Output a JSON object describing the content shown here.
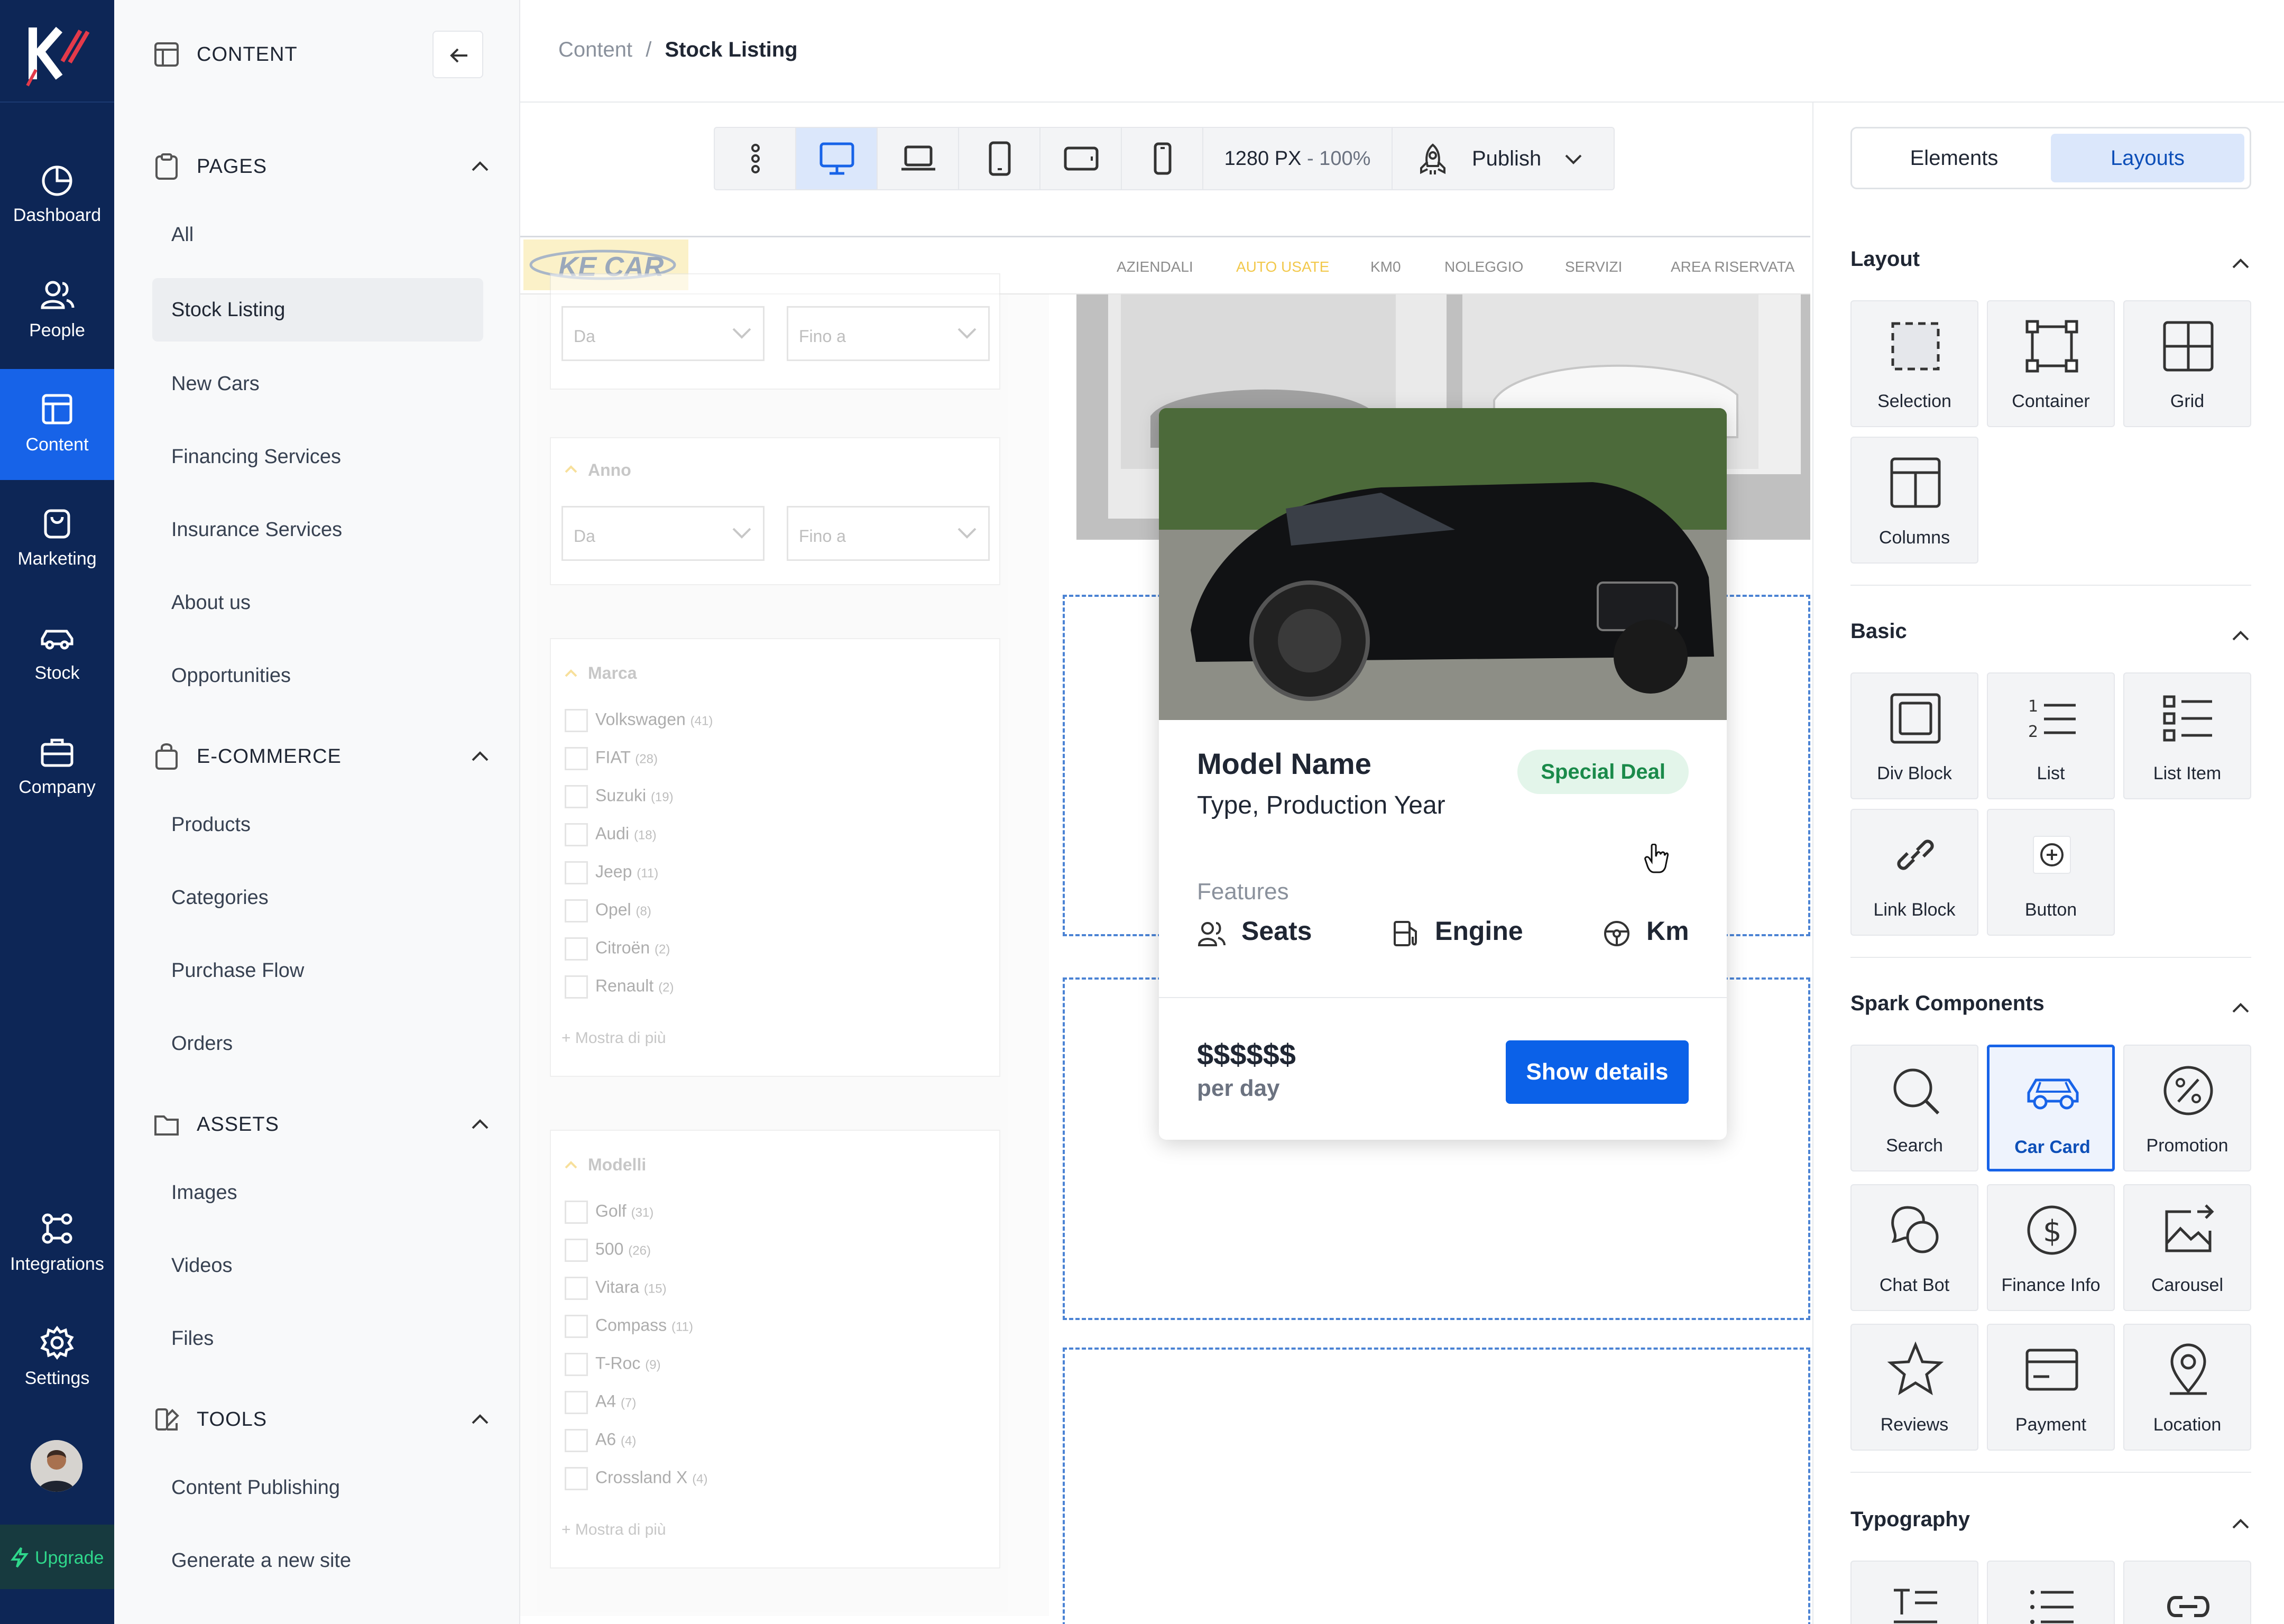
{
  "rail": {
    "logo_letter": "K",
    "items": [
      {
        "label": "Dashboard",
        "icon": "pie-chart-icon"
      },
      {
        "label": "People",
        "icon": "people-icon"
      },
      {
        "label": "Content",
        "icon": "layout-icon",
        "active": true
      },
      {
        "label": "Marketing",
        "icon": "shopping-bag-icon"
      },
      {
        "label": "Stock",
        "icon": "car-icon"
      },
      {
        "label": "Company",
        "icon": "briefcase-icon"
      }
    ],
    "bottom_items": [
      {
        "label": "Integrations",
        "icon": "integrations-icon"
      },
      {
        "label": "Settings",
        "icon": "gear-icon"
      }
    ],
    "upgrade_label": "Upgrade"
  },
  "side": {
    "title": "CONTENT",
    "sections": {
      "pages": {
        "label": "PAGES",
        "items": [
          "All",
          "Stock Listing",
          "New Cars",
          "Financing Services",
          "Insurance Services",
          "About us",
          "Opportunities"
        ],
        "selected": "Stock Listing"
      },
      "ecommerce": {
        "label": "E-COMMERCE",
        "items": [
          "Products",
          "Categories",
          "Purchase Flow",
          "Orders"
        ]
      },
      "assets": {
        "label": "ASSETS",
        "items": [
          "Images",
          "Videos",
          "Files"
        ]
      },
      "tools": {
        "label": "TOOLS",
        "items": [
          "Content Publishing",
          "Generate a new site"
        ]
      }
    }
  },
  "breadcrumb": {
    "parent": "Content",
    "separator": "/",
    "current": "Stock Listing"
  },
  "devicebar": {
    "resolution": "1280 PX",
    "zoom": "- 100%",
    "publish_label": "Publish"
  },
  "site": {
    "brand": "KE CAR",
    "menu": [
      "AZIENDALI",
      "AUTO USATE",
      "KM0",
      "NOLEGGIO",
      "SERVIZI",
      "AREA RISERVATA"
    ],
    "active_menu": "AUTO USATE",
    "filters": {
      "from": "Da",
      "to": "Fino a",
      "year_label": "Anno",
      "brand_label": "Marca",
      "brands": [
        {
          "name": "Volkswagen",
          "count": "(41)"
        },
        {
          "name": "FIAT",
          "count": "(28)"
        },
        {
          "name": "Suzuki",
          "count": "(19)"
        },
        {
          "name": "Audi",
          "count": "(18)"
        },
        {
          "name": "Jeep",
          "count": "(11)"
        },
        {
          "name": "Opel",
          "count": "(8)"
        },
        {
          "name": "Citroën",
          "count": "(2)"
        },
        {
          "name": "Renault",
          "count": "(2)"
        }
      ],
      "more": "Mostra di più",
      "model_label": "Modelli",
      "models": [
        {
          "name": "Golf",
          "count": "(31)"
        },
        {
          "name": "500",
          "count": "(26)"
        },
        {
          "name": "Vitara",
          "count": "(15)"
        },
        {
          "name": "Compass",
          "count": "(11)"
        },
        {
          "name": "T-Roc",
          "count": "(9)"
        },
        {
          "name": "A4",
          "count": "(7)"
        },
        {
          "name": "A6",
          "count": "(4)"
        },
        {
          "name": "Crossland X",
          "count": "(4)"
        }
      ]
    },
    "card": {
      "model": "Model Name",
      "subtitle": "Type, Production Year",
      "badge": "Special Deal",
      "features_label": "Features",
      "features": [
        "Seats",
        "Engine",
        "Km"
      ],
      "price": "$$$$$$",
      "period": "per day",
      "cta": "Show details"
    }
  },
  "rpanel": {
    "tabs": [
      "Elements",
      "Layouts"
    ],
    "active_tab": "Layouts",
    "groups": {
      "layout": {
        "label": "Layout",
        "items": [
          "Selection",
          "Container",
          "Grid",
          "Columns"
        ]
      },
      "basic": {
        "label": "Basic",
        "items": [
          "Div Block",
          "List",
          "List Item",
          "Link Block",
          "Button"
        ]
      },
      "spark": {
        "label": "Spark Components",
        "items": [
          "Search",
          "Car Card",
          "Promotion",
          "Chat Bot",
          "Finance Info",
          "Carousel",
          "Reviews",
          "Payment",
          "Location"
        ],
        "selected": "Car Card"
      },
      "typography": {
        "label": "Typography"
      }
    }
  },
  "colors": {
    "rail_bg": "#0d2656",
    "accent": "#1763e8",
    "success": "#1a8a4a",
    "upgrade": "#2fd78b"
  }
}
